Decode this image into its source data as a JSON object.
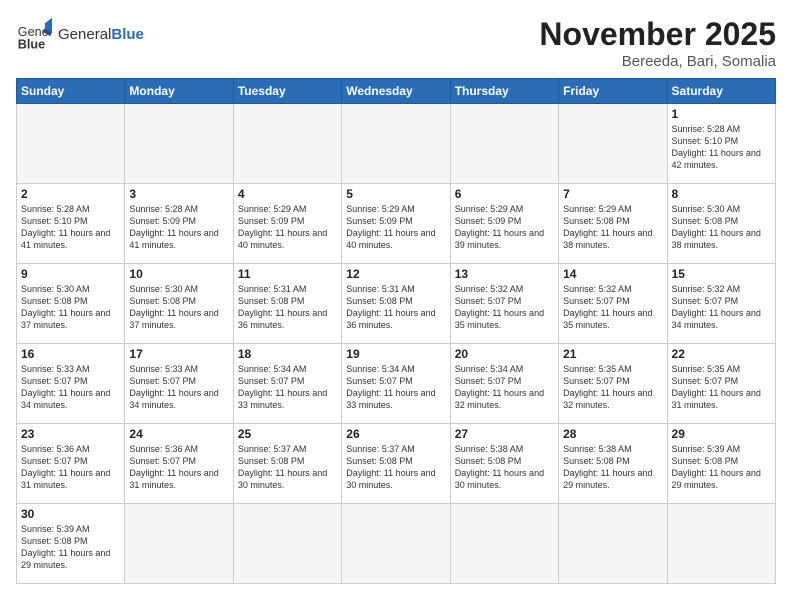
{
  "header": {
    "logo_text_normal": "General",
    "logo_text_bold": "Blue",
    "month": "November 2025",
    "location": "Bereeda, Bari, Somalia"
  },
  "weekdays": [
    "Sunday",
    "Monday",
    "Tuesday",
    "Wednesday",
    "Thursday",
    "Friday",
    "Saturday"
  ],
  "weeks": [
    [
      {
        "day": "",
        "empty": true
      },
      {
        "day": "",
        "empty": true
      },
      {
        "day": "",
        "empty": true
      },
      {
        "day": "",
        "empty": true
      },
      {
        "day": "",
        "empty": true
      },
      {
        "day": "",
        "empty": true
      },
      {
        "day": "1",
        "sunrise": "5:28 AM",
        "sunset": "5:10 PM",
        "daylight": "11 hours and 42 minutes."
      }
    ],
    [
      {
        "day": "2",
        "sunrise": "5:28 AM",
        "sunset": "5:10 PM",
        "daylight": "11 hours and 41 minutes."
      },
      {
        "day": "3",
        "sunrise": "5:28 AM",
        "sunset": "5:09 PM",
        "daylight": "11 hours and 41 minutes."
      },
      {
        "day": "4",
        "sunrise": "5:29 AM",
        "sunset": "5:09 PM",
        "daylight": "11 hours and 40 minutes."
      },
      {
        "day": "5",
        "sunrise": "5:29 AM",
        "sunset": "5:09 PM",
        "daylight": "11 hours and 40 minutes."
      },
      {
        "day": "6",
        "sunrise": "5:29 AM",
        "sunset": "5:09 PM",
        "daylight": "11 hours and 39 minutes."
      },
      {
        "day": "7",
        "sunrise": "5:29 AM",
        "sunset": "5:08 PM",
        "daylight": "11 hours and 38 minutes."
      },
      {
        "day": "8",
        "sunrise": "5:30 AM",
        "sunset": "5:08 PM",
        "daylight": "11 hours and 38 minutes."
      }
    ],
    [
      {
        "day": "9",
        "sunrise": "5:30 AM",
        "sunset": "5:08 PM",
        "daylight": "11 hours and 37 minutes."
      },
      {
        "day": "10",
        "sunrise": "5:30 AM",
        "sunset": "5:08 PM",
        "daylight": "11 hours and 37 minutes."
      },
      {
        "day": "11",
        "sunrise": "5:31 AM",
        "sunset": "5:08 PM",
        "daylight": "11 hours and 36 minutes."
      },
      {
        "day": "12",
        "sunrise": "5:31 AM",
        "sunset": "5:08 PM",
        "daylight": "11 hours and 36 minutes."
      },
      {
        "day": "13",
        "sunrise": "5:32 AM",
        "sunset": "5:07 PM",
        "daylight": "11 hours and 35 minutes."
      },
      {
        "day": "14",
        "sunrise": "5:32 AM",
        "sunset": "5:07 PM",
        "daylight": "11 hours and 35 minutes."
      },
      {
        "day": "15",
        "sunrise": "5:32 AM",
        "sunset": "5:07 PM",
        "daylight": "11 hours and 34 minutes."
      }
    ],
    [
      {
        "day": "16",
        "sunrise": "5:33 AM",
        "sunset": "5:07 PM",
        "daylight": "11 hours and 34 minutes."
      },
      {
        "day": "17",
        "sunrise": "5:33 AM",
        "sunset": "5:07 PM",
        "daylight": "11 hours and 34 minutes."
      },
      {
        "day": "18",
        "sunrise": "5:34 AM",
        "sunset": "5:07 PM",
        "daylight": "11 hours and 33 minutes."
      },
      {
        "day": "19",
        "sunrise": "5:34 AM",
        "sunset": "5:07 PM",
        "daylight": "11 hours and 33 minutes."
      },
      {
        "day": "20",
        "sunrise": "5:34 AM",
        "sunset": "5:07 PM",
        "daylight": "11 hours and 32 minutes."
      },
      {
        "day": "21",
        "sunrise": "5:35 AM",
        "sunset": "5:07 PM",
        "daylight": "11 hours and 32 minutes."
      },
      {
        "day": "22",
        "sunrise": "5:35 AM",
        "sunset": "5:07 PM",
        "daylight": "11 hours and 31 minutes."
      }
    ],
    [
      {
        "day": "23",
        "sunrise": "5:36 AM",
        "sunset": "5:07 PM",
        "daylight": "11 hours and 31 minutes."
      },
      {
        "day": "24",
        "sunrise": "5:36 AM",
        "sunset": "5:07 PM",
        "daylight": "11 hours and 31 minutes."
      },
      {
        "day": "25",
        "sunrise": "5:37 AM",
        "sunset": "5:08 PM",
        "daylight": "11 hours and 30 minutes."
      },
      {
        "day": "26",
        "sunrise": "5:37 AM",
        "sunset": "5:08 PM",
        "daylight": "11 hours and 30 minutes."
      },
      {
        "day": "27",
        "sunrise": "5:38 AM",
        "sunset": "5:08 PM",
        "daylight": "11 hours and 30 minutes."
      },
      {
        "day": "28",
        "sunrise": "5:38 AM",
        "sunset": "5:08 PM",
        "daylight": "11 hours and 29 minutes."
      },
      {
        "day": "29",
        "sunrise": "5:39 AM",
        "sunset": "5:08 PM",
        "daylight": "11 hours and 29 minutes."
      }
    ],
    [
      {
        "day": "30",
        "sunrise": "5:39 AM",
        "sunset": "5:08 PM",
        "daylight": "11 hours and 29 minutes."
      },
      {
        "day": "",
        "empty": true
      },
      {
        "day": "",
        "empty": true
      },
      {
        "day": "",
        "empty": true
      },
      {
        "day": "",
        "empty": true
      },
      {
        "day": "",
        "empty": true
      },
      {
        "day": "",
        "empty": true
      }
    ]
  ],
  "labels": {
    "sunrise": "Sunrise:",
    "sunset": "Sunset:",
    "daylight": "Daylight:"
  }
}
